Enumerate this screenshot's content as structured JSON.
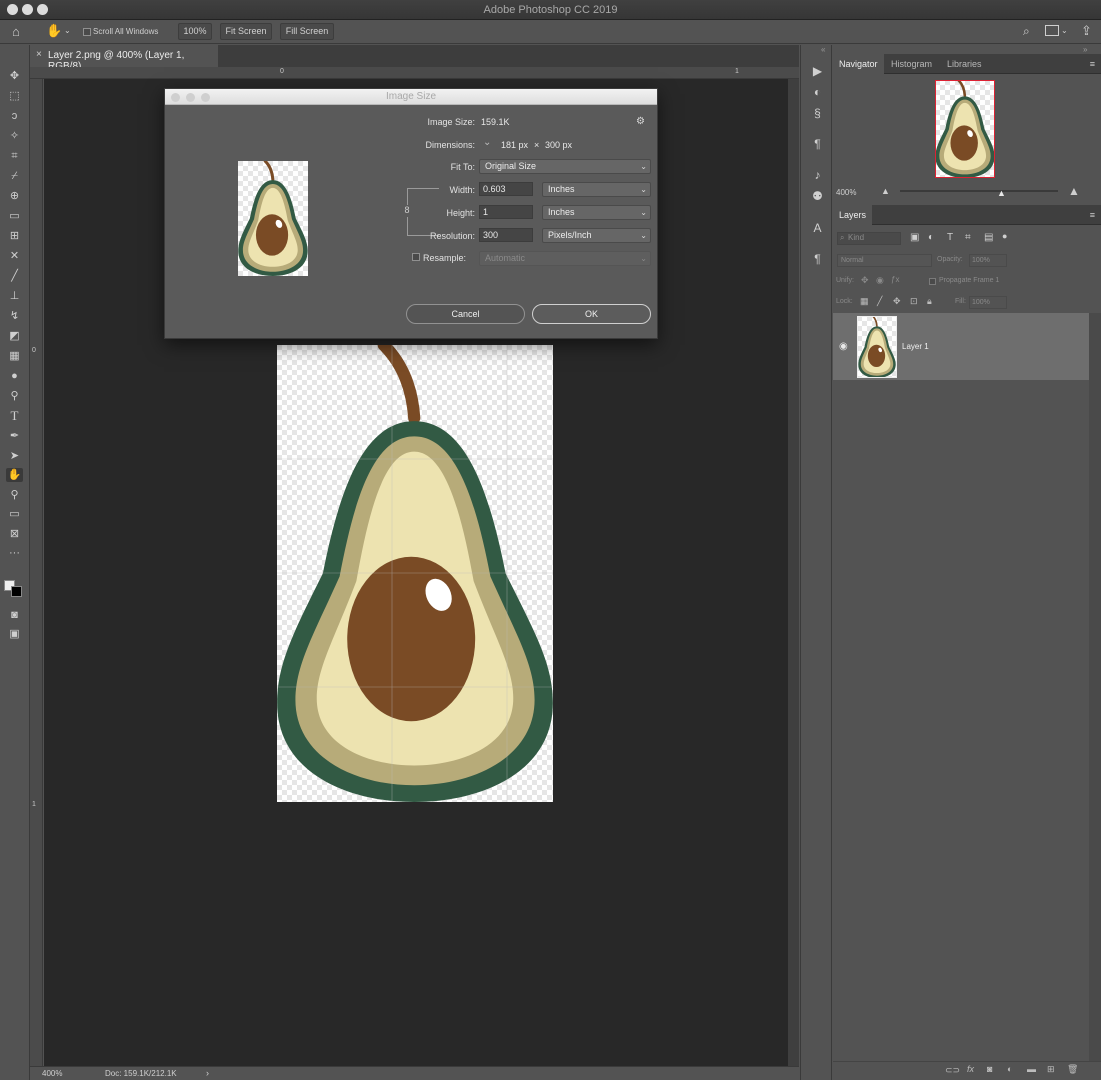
{
  "app": {
    "title": "Adobe Photoshop CC 2019"
  },
  "options": {
    "scroll_all_windows": "Scroll All Windows",
    "zoom_button": "100%",
    "fit_screen": "Fit Screen",
    "fill_screen": "Fill Screen"
  },
  "document": {
    "tab_title": "Layer 2.png @ 400% (Layer 1, RGB/8)",
    "close_glyph": "×",
    "ruler_top_labels": [
      "0",
      "1"
    ],
    "ruler_left_labels": [
      "0",
      "1"
    ]
  },
  "status": {
    "zoom": "400%",
    "doc_size": "Doc: 159.1K/212.1K",
    "arrow": "›"
  },
  "dialog": {
    "title": "Image Size",
    "image_size_label": "Image Size:",
    "image_size_value": "159.1K",
    "dimensions_label": "Dimensions:",
    "dimensions_width": "181 px",
    "dimensions_sep": "×",
    "dimensions_height": "300 px",
    "fit_to_label": "Fit To:",
    "fit_to_value": "Original Size",
    "width_label": "Width:",
    "width_value": "0.603",
    "width_unit": "Inches",
    "height_label": "Height:",
    "height_value": "1",
    "height_unit": "Inches",
    "resolution_label": "Resolution:",
    "resolution_value": "300",
    "resolution_unit": "Pixels/Inch",
    "resample_label": "Resample:",
    "resample_value": "Automatic",
    "cancel": "Cancel",
    "ok": "OK"
  },
  "navigator": {
    "tabs": [
      "Navigator",
      "Histogram",
      "Libraries"
    ],
    "zoom": "400%"
  },
  "layers": {
    "tab": "Layers",
    "kind_placeholder": "Kind",
    "blend_mode": "Normal",
    "opacity_label": "Opacity:",
    "opacity_value": "100%",
    "unify_label": "Unify:",
    "propagate_label": "Propagate Frame 1",
    "lock_label": "Lock:",
    "fill_label": "Fill:",
    "fill_value": "100%",
    "items": [
      {
        "name": "Layer 1"
      }
    ]
  },
  "colors": {
    "avocado_skin": "#325a44",
    "avocado_mid": "#b7ab79",
    "avocado_flesh": "#ede3b0",
    "avocado_pit": "#7a4b25",
    "stem": "#7a4b25"
  }
}
